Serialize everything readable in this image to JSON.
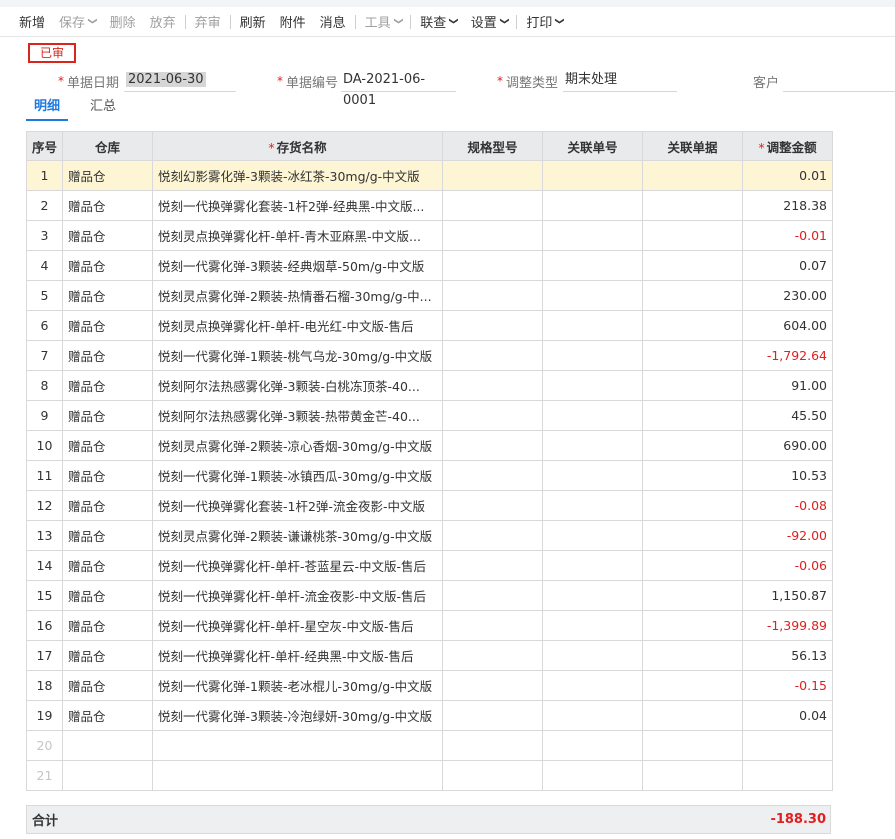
{
  "toolbar": {
    "items": [
      {
        "label": "新增",
        "disabled": false,
        "dropdown": false
      },
      {
        "label": "保存",
        "disabled": true,
        "dropdown": true
      },
      {
        "label": "删除",
        "disabled": true,
        "dropdown": false
      },
      {
        "label": "放弃",
        "disabled": true,
        "dropdown": false
      },
      {
        "label": "弃审",
        "disabled": true,
        "dropdown": false
      },
      {
        "label": "刷新",
        "disabled": false,
        "dropdown": false
      },
      {
        "label": "附件",
        "disabled": false,
        "dropdown": false
      },
      {
        "label": "消息",
        "disabled": false,
        "dropdown": false
      },
      {
        "label": "工具",
        "disabled": true,
        "dropdown": true
      },
      {
        "label": "联查",
        "disabled": false,
        "dropdown": true
      },
      {
        "label": "设置",
        "disabled": false,
        "dropdown": true
      },
      {
        "label": "打印",
        "disabled": false,
        "dropdown": true
      }
    ]
  },
  "status_badge": "已审",
  "form": {
    "date_label": "单据日期",
    "date_value": "2021-06-30",
    "code_label": "单据编号",
    "code_value": "DA-2021-06-0001",
    "type_label": "调整类型",
    "type_value": "期末处理",
    "customer_label": "客户",
    "customer_value": ""
  },
  "tabs": [
    {
      "label": "明细",
      "active": true
    },
    {
      "label": "汇总",
      "active": false
    }
  ],
  "table": {
    "columns": [
      {
        "label": "序号",
        "required": false
      },
      {
        "label": "仓库",
        "required": false
      },
      {
        "label": "存货名称",
        "required": true
      },
      {
        "label": "规格型号",
        "required": false
      },
      {
        "label": "关联单号",
        "required": false
      },
      {
        "label": "关联单据",
        "required": false
      },
      {
        "label": "调整金额",
        "required": true
      }
    ],
    "rows": [
      {
        "seq": "1",
        "warehouse": "赠品仓",
        "item": "悦刻幻影雾化弹-3颗装-冰红茶-30mg/g-中文版",
        "spec": "",
        "ref_no": "",
        "ref_doc": "",
        "amount": "0.01",
        "negative": false,
        "selected": true
      },
      {
        "seq": "2",
        "warehouse": "赠品仓",
        "item": "悦刻一代换弹雾化套装-1杆2弹-经典黑-中文版...",
        "spec": "",
        "ref_no": "",
        "ref_doc": "",
        "amount": "218.38",
        "negative": false
      },
      {
        "seq": "3",
        "warehouse": "赠品仓",
        "item": "悦刻灵点换弹雾化杆-单杆-青木亚麻黑-中文版...",
        "spec": "",
        "ref_no": "",
        "ref_doc": "",
        "amount": "-0.01",
        "negative": true
      },
      {
        "seq": "4",
        "warehouse": "赠品仓",
        "item": "悦刻一代雾化弹-3颗装-经典烟草-50m/g-中文版",
        "spec": "",
        "ref_no": "",
        "ref_doc": "",
        "amount": "0.07",
        "negative": false
      },
      {
        "seq": "5",
        "warehouse": "赠品仓",
        "item": "悦刻灵点雾化弹-2颗装-热情番石榴-30mg/g-中...",
        "spec": "",
        "ref_no": "",
        "ref_doc": "",
        "amount": "230.00",
        "negative": false
      },
      {
        "seq": "6",
        "warehouse": "赠品仓",
        "item": "悦刻灵点换弹雾化杆-单杆-电光红-中文版-售后",
        "spec": "",
        "ref_no": "",
        "ref_doc": "",
        "amount": "604.00",
        "negative": false
      },
      {
        "seq": "7",
        "warehouse": "赠品仓",
        "item": "悦刻一代雾化弹-1颗装-桃气乌龙-30mg/g-中文版",
        "spec": "",
        "ref_no": "",
        "ref_doc": "",
        "amount": "-1,792.64",
        "negative": true
      },
      {
        "seq": "8",
        "warehouse": "赠品仓",
        "item": "悦刻阿尔法热感雾化弹-3颗装-白桃冻顶茶-40...",
        "spec": "",
        "ref_no": "",
        "ref_doc": "",
        "amount": "91.00",
        "negative": false
      },
      {
        "seq": "9",
        "warehouse": "赠品仓",
        "item": "悦刻阿尔法热感雾化弹-3颗装-热带黄金芒-40...",
        "spec": "",
        "ref_no": "",
        "ref_doc": "",
        "amount": "45.50",
        "negative": false
      },
      {
        "seq": "10",
        "warehouse": "赠品仓",
        "item": "悦刻灵点雾化弹-2颗装-凉心香烟-30mg/g-中文版",
        "spec": "",
        "ref_no": "",
        "ref_doc": "",
        "amount": "690.00",
        "negative": false
      },
      {
        "seq": "11",
        "warehouse": "赠品仓",
        "item": "悦刻一代雾化弹-1颗装-冰镇西瓜-30mg/g-中文版",
        "spec": "",
        "ref_no": "",
        "ref_doc": "",
        "amount": "10.53",
        "negative": false
      },
      {
        "seq": "12",
        "warehouse": "赠品仓",
        "item": "悦刻一代换弹雾化套装-1杆2弹-流金夜影-中文版",
        "spec": "",
        "ref_no": "",
        "ref_doc": "",
        "amount": "-0.08",
        "negative": true
      },
      {
        "seq": "13",
        "warehouse": "赠品仓",
        "item": "悦刻灵点雾化弹-2颗装-谦谦桃茶-30mg/g-中文版",
        "spec": "",
        "ref_no": "",
        "ref_doc": "",
        "amount": "-92.00",
        "negative": true
      },
      {
        "seq": "14",
        "warehouse": "赠品仓",
        "item": "悦刻一代换弹雾化杆-单杆-苍蓝星云-中文版-售后",
        "spec": "",
        "ref_no": "",
        "ref_doc": "",
        "amount": "-0.06",
        "negative": true
      },
      {
        "seq": "15",
        "warehouse": "赠品仓",
        "item": "悦刻一代换弹雾化杆-单杆-流金夜影-中文版-售后",
        "spec": "",
        "ref_no": "",
        "ref_doc": "",
        "amount": "1,150.87",
        "negative": false
      },
      {
        "seq": "16",
        "warehouse": "赠品仓",
        "item": "悦刻一代换弹雾化杆-单杆-星空灰-中文版-售后",
        "spec": "",
        "ref_no": "",
        "ref_doc": "",
        "amount": "-1,399.89",
        "negative": true
      },
      {
        "seq": "17",
        "warehouse": "赠品仓",
        "item": "悦刻一代换弹雾化杆-单杆-经典黑-中文版-售后",
        "spec": "",
        "ref_no": "",
        "ref_doc": "",
        "amount": "56.13",
        "negative": false
      },
      {
        "seq": "18",
        "warehouse": "赠品仓",
        "item": "悦刻一代雾化弹-1颗装-老冰棍儿-30mg/g-中文版",
        "spec": "",
        "ref_no": "",
        "ref_doc": "",
        "amount": "-0.15",
        "negative": true
      },
      {
        "seq": "19",
        "warehouse": "赠品仓",
        "item": "悦刻一代雾化弹-3颗装-冷泡绿妍-30mg/g-中文版",
        "spec": "",
        "ref_no": "",
        "ref_doc": "",
        "amount": "0.04",
        "negative": false
      }
    ],
    "empty_rows": [
      "20",
      "21"
    ]
  },
  "total": {
    "label": "合计",
    "value": "-188.30"
  },
  "colors": {
    "accent": "#1f7ae0",
    "negative": "#e02020",
    "selected_row": "#fdf5d3",
    "header_bg": "#e9eaec"
  }
}
